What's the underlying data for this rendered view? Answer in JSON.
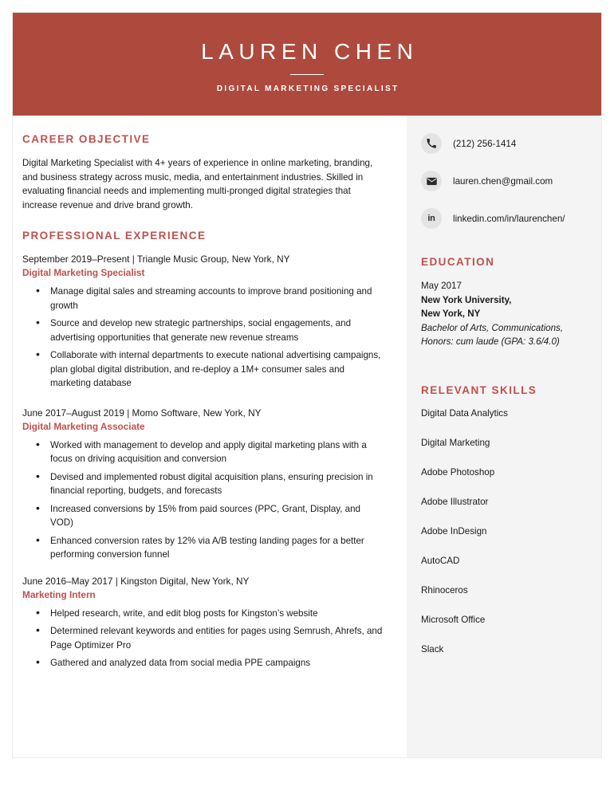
{
  "header": {
    "name": "LAUREN CHEN",
    "subtitle": "DIGITAL MARKETING SPECIALIST",
    "bg_color": "#ad4a3d"
  },
  "theme": {
    "accent": "#c0504d",
    "sidebar_bg": "#f4f4f4",
    "text": "#1a1a1a"
  },
  "main": {
    "objective": {
      "heading": "CAREER OBJECTIVE",
      "text": "Digital Marketing Specialist with 4+ years of experience in online marketing, branding, and business strategy across music, media, and entertainment industries. Skilled in evaluating financial needs and implementing multi-pronged digital strategies that increase revenue and drive brand growth."
    },
    "experience": {
      "heading": "PROFESSIONAL EXPERIENCE",
      "jobs": [
        {
          "meta": "September 2019–Present | Triangle Music Group, New York, NY",
          "role": "Digital Marketing Specialist",
          "bullets": [
            "Manage digital sales and streaming accounts to improve brand positioning and growth",
            "Source and develop new strategic partnerships, social engagements, and advertising opportunities that generate new revenue streams",
            "Collaborate with internal departments to execute national advertising campaigns, plan global digital distribution, and re-deploy a 1M+ consumer sales and marketing database"
          ]
        },
        {
          "meta": "June 2017–August 2019 | Momo Software, New York, NY",
          "role": "Digital Marketing Associate",
          "bullets": [
            "Worked with management to develop and apply digital marketing plans with a focus on driving acquisition and conversion",
            "Devised and implemented robust digital acquisition plans, ensuring precision in financial reporting, budgets, and forecasts",
            "Increased conversions by 15% from paid sources (PPC, Grant, Display, and VOD)",
            "Enhanced conversion rates by 12% via A/B testing landing pages for a better performing conversion funnel"
          ]
        },
        {
          "meta": "June 2016–May 2017 | Kingston Digital, New York, NY",
          "role": "Marketing Intern",
          "bullets": [
            "Helped research, write, and edit blog posts for Kingston’s website",
            "Determined relevant keywords and entities for pages using Semrush, Ahrefs, and Page Optimizer Pro",
            "Gathered and analyzed data from social media PPE campaigns"
          ]
        }
      ]
    }
  },
  "sidebar": {
    "contact": [
      {
        "icon": "phone-icon",
        "value": "(212) 256-1414"
      },
      {
        "icon": "email-icon",
        "value": "lauren.chen@gmail.com"
      },
      {
        "icon": "linkedin-icon",
        "value": "linkedin.com/in/laurenchen/",
        "glyph": "in"
      }
    ],
    "education": {
      "heading": "EDUCATION",
      "date": "May 2017",
      "school_line1": "New York University,",
      "school_line2": "New York, NY",
      "degree": "Bachelor of Arts, Communications,",
      "honors": "Honors: cum laude (GPA: 3.6/4.0)"
    },
    "skills": {
      "heading": "RELEVANT SKILLS",
      "items": [
        "Digital Data Analytics",
        "Digital Marketing",
        "Adobe Photoshop",
        "Adobe Illustrator",
        "Adobe InDesign",
        "AutoCAD",
        "Rhinoceros",
        "Microsoft Office",
        "Slack"
      ]
    }
  }
}
